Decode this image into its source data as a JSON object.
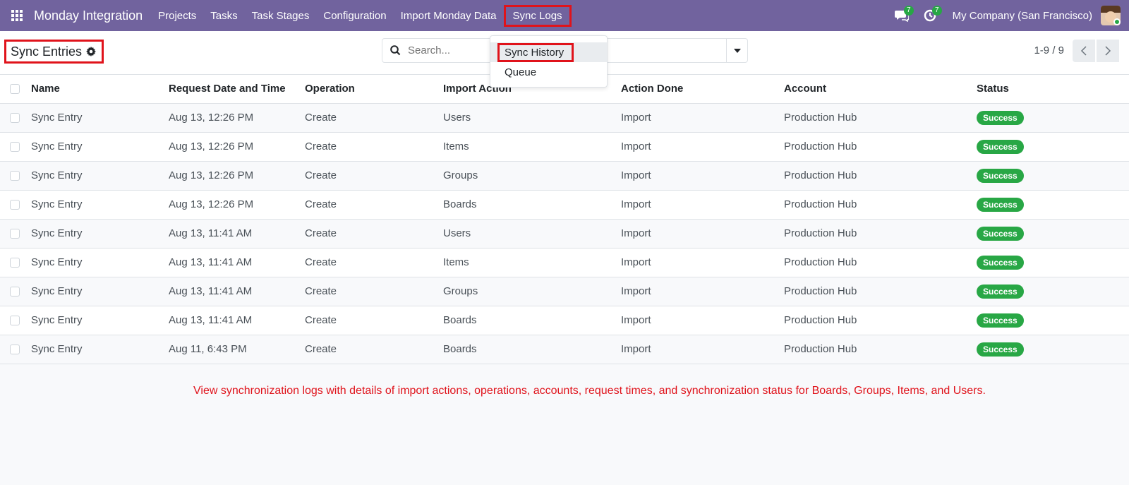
{
  "nav": {
    "brand": "Monday Integration",
    "menu": [
      "Projects",
      "Tasks",
      "Task Stages",
      "Configuration",
      "Import Monday Data"
    ],
    "active_menu": "Sync Logs",
    "messages_count": "7",
    "activities_count": "7",
    "company": "My Company (San Francisco)"
  },
  "breadcrumb": {
    "title": "Sync Entries"
  },
  "search": {
    "placeholder": "Search..."
  },
  "pager": {
    "value": "1-9 / 9"
  },
  "dropdown": {
    "items": [
      "Sync History",
      "Queue"
    ],
    "active": "Sync History"
  },
  "table": {
    "headers": [
      "Name",
      "Request Date and Time",
      "Operation",
      "Import Action",
      "Action Done",
      "Account",
      "Status"
    ],
    "rows": [
      [
        "Sync Entry",
        "Aug 13, 12:26 PM",
        "Create",
        "Users",
        "Import",
        "Production Hub",
        "Success"
      ],
      [
        "Sync Entry",
        "Aug 13, 12:26 PM",
        "Create",
        "Items",
        "Import",
        "Production Hub",
        "Success"
      ],
      [
        "Sync Entry",
        "Aug 13, 12:26 PM",
        "Create",
        "Groups",
        "Import",
        "Production Hub",
        "Success"
      ],
      [
        "Sync Entry",
        "Aug 13, 12:26 PM",
        "Create",
        "Boards",
        "Import",
        "Production Hub",
        "Success"
      ],
      [
        "Sync Entry",
        "Aug 13, 11:41 AM",
        "Create",
        "Users",
        "Import",
        "Production Hub",
        "Success"
      ],
      [
        "Sync Entry",
        "Aug 13, 11:41 AM",
        "Create",
        "Items",
        "Import",
        "Production Hub",
        "Success"
      ],
      [
        "Sync Entry",
        "Aug 13, 11:41 AM",
        "Create",
        "Groups",
        "Import",
        "Production Hub",
        "Success"
      ],
      [
        "Sync Entry",
        "Aug 13, 11:41 AM",
        "Create",
        "Boards",
        "Import",
        "Production Hub",
        "Success"
      ],
      [
        "Sync Entry",
        "Aug 11, 6:43 PM",
        "Create",
        "Boards",
        "Import",
        "Production Hub",
        "Success"
      ]
    ]
  },
  "caption": "View synchronization logs with details of import actions, operations, accounts, request times, and synchronization status for Boards, Groups, Items, and Users.",
  "colors": {
    "navbar": "#71639e",
    "success": "#28a745",
    "highlight": "#e0131b"
  }
}
